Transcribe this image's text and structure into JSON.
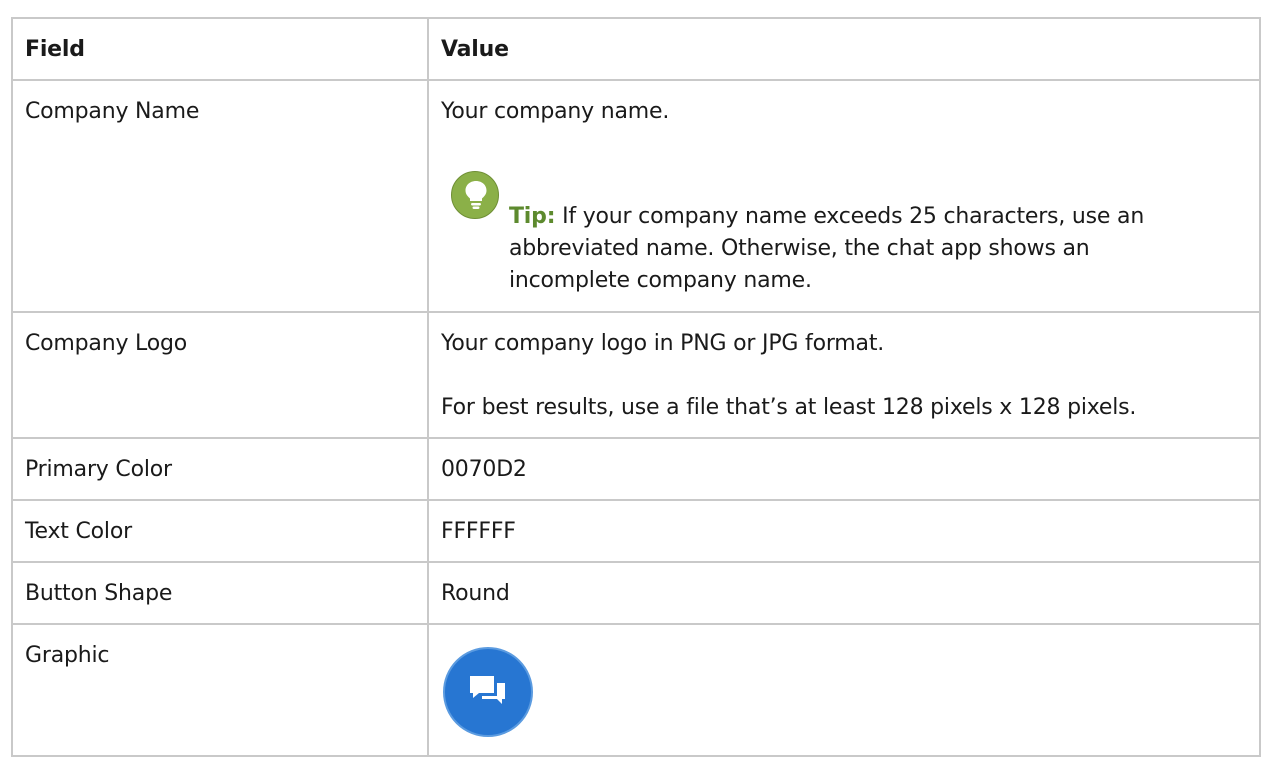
{
  "table": {
    "header": {
      "field": "Field",
      "value": "Value"
    },
    "rows": [
      {
        "field": "Company Name",
        "value": "Your company name.",
        "tip": {
          "label": "Tip:",
          "text_line1": "If your company name exceeds 25 characters, use an",
          "text_line2": "abbreviated name. Otherwise, the chat app shows an",
          "text_line3": "incomplete company name.",
          "icon": "lightbulb-icon",
          "icon_color": "#8bb048",
          "label_color": "#5d8a2e"
        }
      },
      {
        "field": "Company Logo",
        "value": "Your company logo in PNG or JPG format.",
        "value_note": "For best results, use a file that’s at least 128 pixels x 128 pixels."
      },
      {
        "field": "Primary Color",
        "value": "0070D2"
      },
      {
        "field": "Text Color",
        "value": "FFFFFF"
      },
      {
        "field": "Button Shape",
        "value": "Round"
      },
      {
        "field": "Graphic",
        "graphic": {
          "icon": "chat-bubbles-icon",
          "background": "#2776d2",
          "foreground": "#ffffff"
        }
      }
    ]
  }
}
